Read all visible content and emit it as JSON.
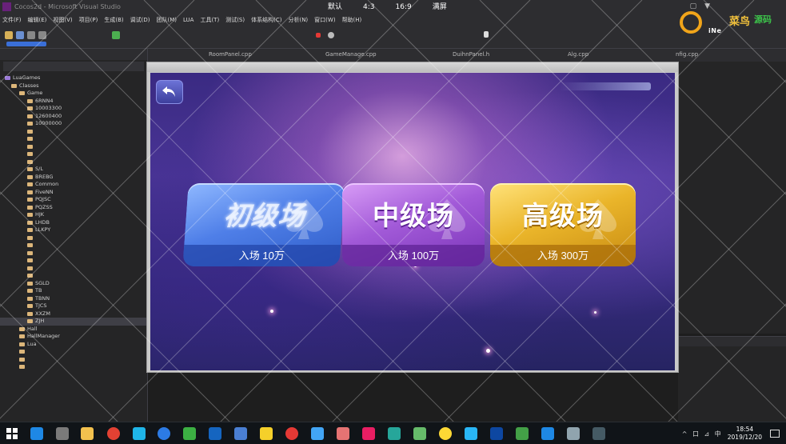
{
  "ide": {
    "title": "Cocos2d - Microsoft Visual Studio",
    "menus": [
      "文件(F)",
      "编辑(E)",
      "视图(V)",
      "项目(P)",
      "生成(B)",
      "调试(D)",
      "团队(M)",
      "LUA",
      "工具(T)",
      "测试(S)",
      "体系结构(C)",
      "分析(N)",
      "窗口(W)",
      "帮助(H)"
    ],
    "doc_tabs": [
      "RoomPanel.cpp",
      "GameManage.cpp",
      "DuihnPanel.h",
      "Alg.cpp",
      "nfig.cpp"
    ],
    "solution_root": "LuaGames",
    "tree": [
      "LuaGames",
      "Classes",
      "Game",
      "6RNN4",
      "10003300",
      "12600400",
      "10000000",
      "",
      "",
      "",
      "",
      "",
      "S/L",
      "BREBG",
      "Common",
      "FiveNN",
      "PQJSC",
      "PQZSS",
      "HJK",
      "LHDB",
      "LLKPY",
      "",
      "",
      "",
      "",
      "",
      "",
      "SGLD",
      "TB",
      "TBNN",
      "TJCS",
      "XXZM",
      "ZJH",
      "Hall",
      "HallManager",
      "Lua",
      "",
      "",
      ""
    ]
  },
  "emulator_bar": {
    "default_label": "默认",
    "ratio_43": "4:3",
    "ratio_169": "16:9",
    "fullscreen_label": "满屏"
  },
  "logo": {
    "cn_text": "菜鸟",
    "cn_text2": "源码",
    "en_text": "iNe"
  },
  "game": {
    "rooms": [
      {
        "title": "初级场",
        "entry": "入场 10万",
        "color": "#4f7fe8"
      },
      {
        "title": "中级场",
        "entry": "入场 100万",
        "color": "#a25ad8"
      },
      {
        "title": "高级场",
        "entry": "入场 300万",
        "color": "#eab52a"
      }
    ]
  },
  "taskbar": {
    "time": "18:54",
    "date": "2019/12/20",
    "ime": "中",
    "tray_icons": "^ 口 ⊿ 中"
  },
  "colors": {
    "ide_bg": "#1e1e1e",
    "accent_orange": "#f1a51a"
  }
}
